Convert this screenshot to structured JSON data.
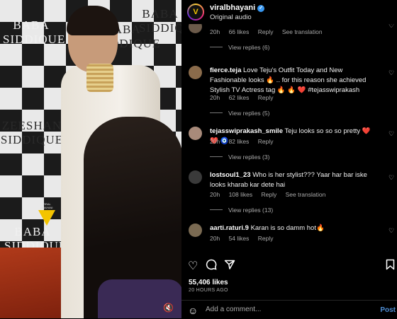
{
  "video": {
    "banner_text": [
      "BABA SIDDIQUE",
      "ZEESHAN SIDDIQUE",
      "BABA SIDDIQUE",
      "BABA SIDDIQUE",
      "BABA SIDDIQUE"
    ],
    "mute_icon": "speaker-muted-icon"
  },
  "header": {
    "account": "viralbhayani",
    "audio": "Original audio",
    "avatar_letter": "V"
  },
  "comments": [
    {
      "user": "",
      "text": "",
      "time": "20h",
      "likes": "66 likes",
      "reply": "Reply",
      "translate": "See translation",
      "view_replies": "View replies (6)",
      "avatar_color": "#6b5a4a"
    },
    {
      "user": "fierce.teja",
      "text": "Love Teju's Outfit Today and New Fashionable looks 🔥 .. for this reason she achieved Stylish TV Actress tag 🔥 🔥 ❤️ #tejasswiprakash",
      "time": "20h",
      "likes": "62 likes",
      "reply": "Reply",
      "translate": "",
      "view_replies": "View replies (5)",
      "avatar_color": "#8a6b4b"
    },
    {
      "user": "tejasswiprakash_smile",
      "text": "Teju looks so so so pretty ❤️ ❤️ 🧿",
      "time": "20h",
      "likes": "82 likes",
      "reply": "Reply",
      "translate": "",
      "view_replies": "View replies (3)",
      "avatar_color": "#a88a7a"
    },
    {
      "user": "lostsoul1_23",
      "text": "Who is her stylist??? Yaar har bar iske looks kharab kar dete hai",
      "time": "20h",
      "likes": "108 likes",
      "reply": "Reply",
      "translate": "See translation",
      "view_replies": "View replies (13)",
      "avatar_color": "#3a3a3a"
    },
    {
      "user": "aarti.raturi.9",
      "text": "Karan is so damm hot🔥",
      "time": "20h",
      "likes": "54 likes",
      "reply": "Reply",
      "translate": "",
      "view_replies": "",
      "avatar_color": "#7a6a52"
    }
  ],
  "actions": {
    "like_icon": "heart-icon",
    "comment_icon": "comment-icon",
    "share_icon": "share-icon",
    "save_icon": "bookmark-icon"
  },
  "likes": "55,406 likes",
  "timestamp": "20 HOURS AGO",
  "add_comment": {
    "placeholder": "Add a comment...",
    "post_label": "Post"
  }
}
